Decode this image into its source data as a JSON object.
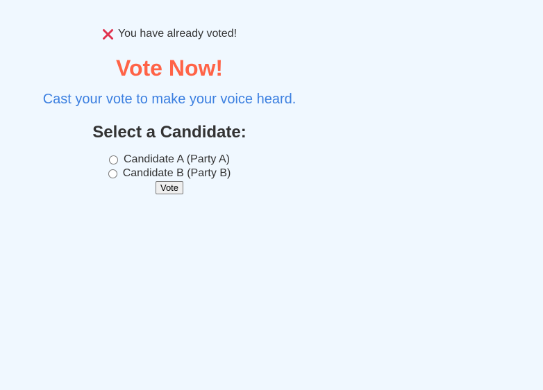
{
  "status": {
    "icon": "cross-icon",
    "message": "You have already voted!",
    "icon_color": "#e0334f"
  },
  "header": {
    "title": "Vote Now!",
    "subtitle": "Cast your vote to make your voice heard."
  },
  "ballot": {
    "heading": "Select a Candidate:",
    "options": [
      {
        "label": "Candidate A (Party A)",
        "selected": false
      },
      {
        "label": "Candidate B (Party B)",
        "selected": false
      }
    ],
    "submit_label": "Vote"
  },
  "colors": {
    "background": "#f0f8ff",
    "title": "#ff6347",
    "subtitle": "#3b7fe0",
    "text": "#333333"
  }
}
